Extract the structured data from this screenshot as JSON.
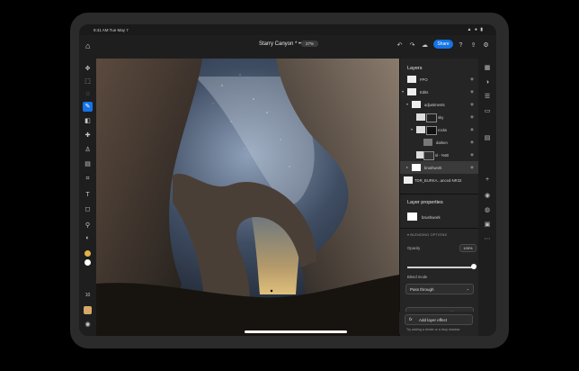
{
  "status": {
    "time": "9:41 AM   Tue May 7",
    "system_icons": "▲ ● ▮"
  },
  "topbar": {
    "doc_title": "Starry Canyon * •••",
    "zoom": "27%",
    "share_label": "Share"
  },
  "layers_panel": {
    "title": "Layers",
    "layers": [
      {
        "name": "FPO"
      },
      {
        "name": "Edits"
      },
      {
        "name": "adjustments"
      },
      {
        "name": "sky"
      },
      {
        "name": "rocks"
      },
      {
        "name": "darken"
      },
      {
        "name": "sl - %60"
      },
      {
        "name": "brushwork"
      },
      {
        "name": "TDR_BURKA...anced-NR33"
      }
    ]
  },
  "properties": {
    "title": "Layer properties",
    "layer_name": "brushwork",
    "blending_label": "BLENDING OPTIONS",
    "opacity_label": "Opacity",
    "opacity_value": "100%",
    "opacity": 1.0,
    "blend_mode_label": "Blend mode",
    "blend_mode": "Pass through",
    "convert_label": "Convert to smart object",
    "effects_label": "EFFECTS",
    "add_effect_label": "Add layer effect",
    "hint": "Try adding a stroke or a drop shadow"
  },
  "colors": {
    "accent": "#1473e6",
    "panel_bg": "#252525"
  }
}
